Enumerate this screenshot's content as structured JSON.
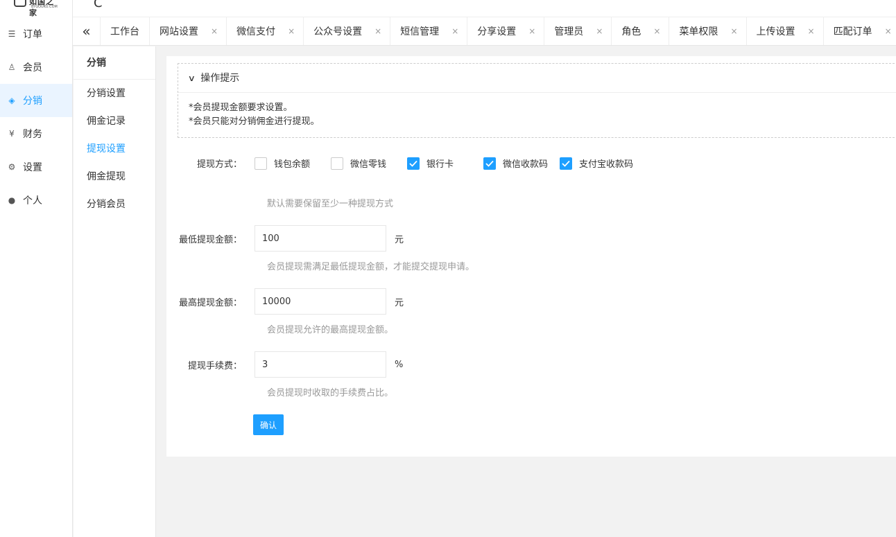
{
  "logo": {
    "text": "如国之家",
    "sub": "BYGOUKU.COM"
  },
  "sidebar": {
    "items": [
      {
        "label": "订单",
        "icon": "list-icon",
        "glyph": "☰"
      },
      {
        "label": "会员",
        "icon": "user-icon",
        "glyph": "♙"
      },
      {
        "label": "分销",
        "icon": "layers-icon",
        "glyph": "◈"
      },
      {
        "label": "财务",
        "icon": "yen-icon",
        "glyph": "¥"
      },
      {
        "label": "设置",
        "icon": "gear-icon",
        "glyph": "⚙"
      },
      {
        "label": "个人",
        "icon": "person-icon",
        "glyph": "●"
      }
    ],
    "active_index": 2
  },
  "topbar": {
    "refresh_glyph": "C"
  },
  "tabs": {
    "collapse_glyph": "«",
    "home": "工作台",
    "items": [
      "网站设置",
      "微信支付",
      "公众号设置",
      "短信管理",
      "分享设置",
      "管理员",
      "角色",
      "菜单权限",
      "上传设置",
      "匹配订单"
    ],
    "close_glyph": "×"
  },
  "subnav": {
    "title": "分销",
    "items": [
      "分销设置",
      "佣金记录",
      "提现设置",
      "佣金提现",
      "分销会员"
    ],
    "active_index": 2
  },
  "tips": {
    "title": "操作提示",
    "lines": [
      "*会员提现金额要求设置。",
      "*会员只能对分销佣金进行提现。"
    ]
  },
  "form": {
    "method": {
      "label": "提现方式：",
      "options": [
        {
          "label": "钱包余额",
          "checked": false
        },
        {
          "label": "微信零钱",
          "checked": false
        },
        {
          "label": "银行卡",
          "checked": true
        },
        {
          "label": "微信收款码",
          "checked": true
        },
        {
          "label": "支付宝收款码",
          "checked": true
        }
      ],
      "hint": "默认需要保留至少一种提现方式"
    },
    "min": {
      "label": "最低提现金额：",
      "value": "100",
      "unit": "元",
      "hint": "会员提现需满足最低提现金额，才能提交提现申请。"
    },
    "max": {
      "label": "最高提现金额：",
      "value": "10000",
      "unit": "元",
      "hint": "会员提现允许的最高提现金额。"
    },
    "fee": {
      "label": "提现手续费：",
      "value": "3",
      "unit": "%",
      "hint": "会员提现时收取的手续费占比。"
    },
    "submit": "确认"
  },
  "colors": {
    "accent": "#1E9FFF",
    "active_bg": "#eaf4ff"
  }
}
